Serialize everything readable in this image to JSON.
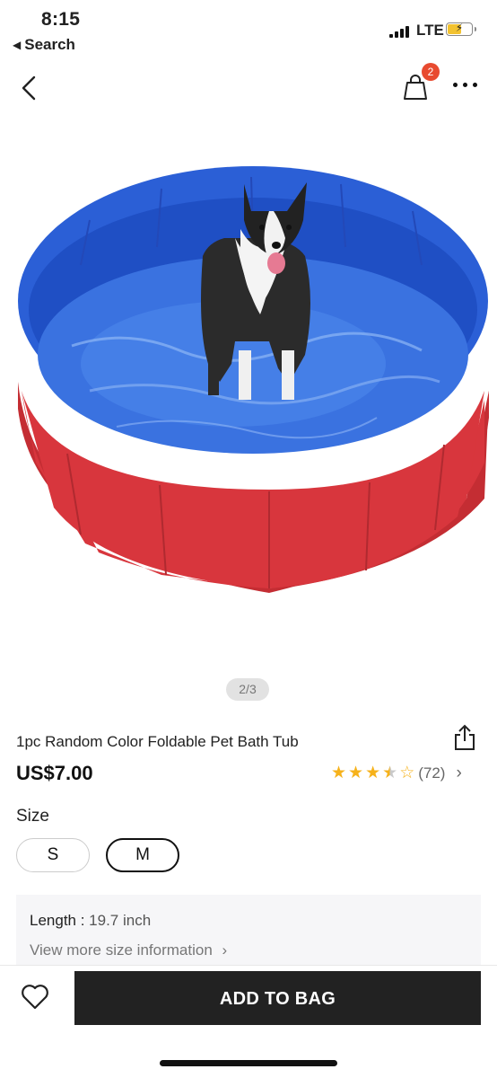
{
  "status_bar": {
    "time": "8:15",
    "back_app": "Search",
    "network": "LTE",
    "battery_level": 0.55,
    "battery_charging": true
  },
  "nav": {
    "back_icon": "chevron-left-icon",
    "bag_icon": "shopping-bag-icon",
    "bag_count": "2",
    "more_icon": "more-horizontal-icon"
  },
  "product": {
    "image_pager": "2/3",
    "title": "1pc Random Color Foldable Pet Bath Tub",
    "price": "US$7.00",
    "rating": 3.5,
    "rating_max": 5,
    "review_count": "(72)",
    "star_color": "#f6b21b"
  },
  "size": {
    "label": "Size",
    "options": [
      "S",
      "M"
    ],
    "selected": "M"
  },
  "size_info": {
    "length_label": "Length : ",
    "length_value": "19.7 inch",
    "view_more": "View more size information"
  },
  "footer": {
    "add_to_bag": "ADD TO BAG",
    "button_color": "#222222"
  },
  "colors": {
    "badge": "#e84a2f",
    "pool_blue": "#2b5fd6",
    "pool_red": "#d8363d"
  }
}
